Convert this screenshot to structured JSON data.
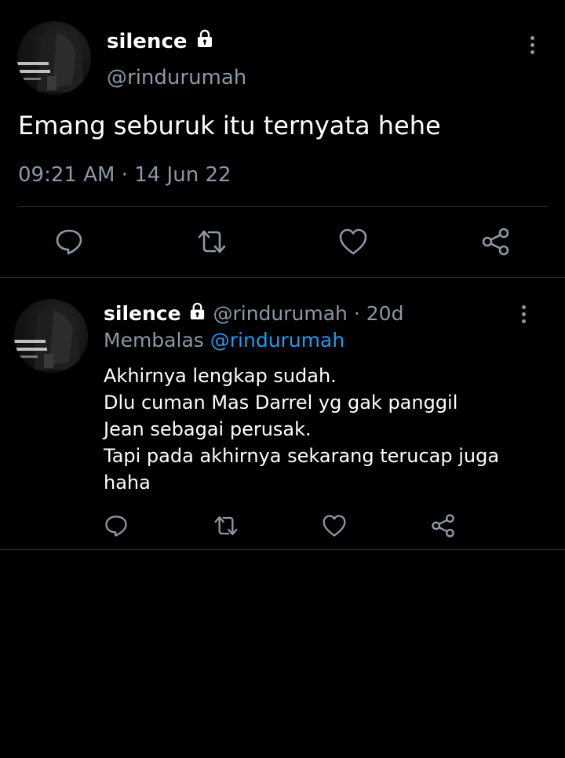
{
  "main_tweet": {
    "display_name": "silence",
    "handle": "@rindurumah",
    "text": "Emang seburuk itu ternyata hehe",
    "timestamp": "09:21 AM · 14 Jun 22"
  },
  "reply": {
    "display_name": "silence",
    "handle": "@rindurumah",
    "age": "· 20d",
    "replying_prefix": "Membalas",
    "replying_to": "@rindurumah",
    "text": "Akhirnya lengkap sudah.\nDlu cuman Mas Darrel yg gak panggil\nJean sebagai perusak.\nTapi pada akhirnya sekarang terucap juga\nhaha"
  },
  "icons": {
    "reply": "comment-icon",
    "retweet": "retweet-icon",
    "like": "heart-icon",
    "share": "share-icon",
    "more": "more-vertical-icon",
    "lock": "lock-icon"
  },
  "colors": {
    "background": "#000000",
    "text": "#e7e9ea",
    "muted": "#8b98a5",
    "link": "#1d9bf0",
    "divider": "#2f3336"
  }
}
